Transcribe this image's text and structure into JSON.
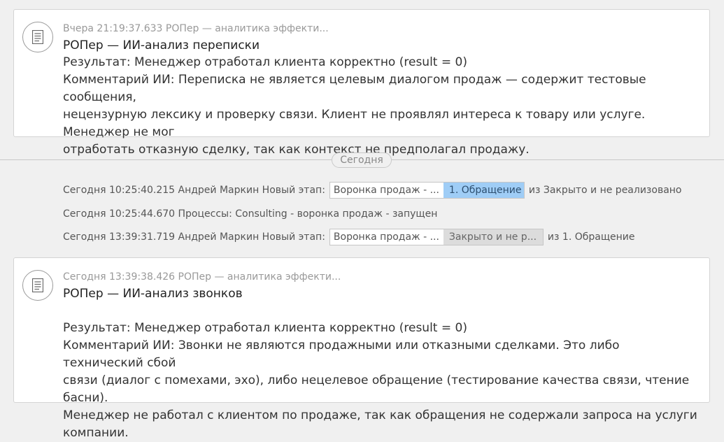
{
  "feed": {
    "card1": {
      "meta": "Вчера 21:19:37.633 РОПер — аналитика эффекти...",
      "title": "РОПер — ИИ-анализ переписки",
      "result": "Результат: Менеджер отработал клиента корректно (result = 0)",
      "comment_lines": [
        "Комментарий ИИ: Переписка не является целевым диалогом продаж — содержит тестовые сообщения,",
        "нецензурную лексику и проверку связи. Клиент не проявлял интереса к товару или услуге. Менеджер не мог",
        "отработать отказную сделку, так как контекст не предполагал продажу."
      ]
    },
    "date_separator": "Сегодня",
    "event1": {
      "text": "Сегодня 10:25:40.215 Андрей Маркин Новый этап:",
      "pipeline": "Воронка продаж - ...",
      "stage": "1. Обращение",
      "suffix": "из Закрыто и не реализовано"
    },
    "event2": {
      "text": "Сегодня 10:25:44.670 Процессы: Consulting - воронка продаж - запущен"
    },
    "event3": {
      "text": "Сегодня 13:39:31.719 Андрей Маркин Новый этап:",
      "pipeline": "Воронка продаж - ...",
      "stage": "Закрыто и не р...",
      "suffix": "из 1. Обращение"
    },
    "card2": {
      "meta": "Сегодня 13:39:38.426 РОПер — аналитика эффекти...",
      "title": "РОПер — ИИ-анализ звонков",
      "result": "Результат: Менеджер отработал клиента корректно (result = 0)",
      "comment_lines": [
        "Комментарий ИИ: Звонки не являются продажными или отказными сделками. Это либо технический сбой",
        "связи (диалог с помехами, эхо), либо нецелевое обращение (тестирование качества связи, чтение басни).",
        "Менеджер не работал с клиентом по продаже, так как обращения не содержали запроса на услуги компании."
      ]
    }
  },
  "icons": {
    "note": "document-note-icon"
  },
  "colors": {
    "active_stage": "#9fcdf6",
    "closed_stage": "#dcdcdc",
    "background": "#f0f0f0"
  }
}
